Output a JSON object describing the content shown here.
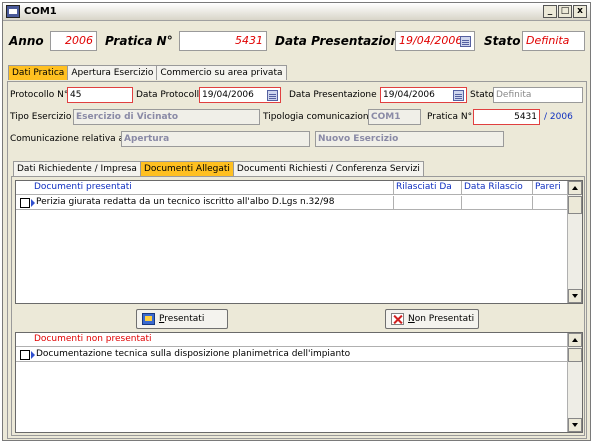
{
  "window": {
    "title": "COM1",
    "buttons": [
      "_",
      "□",
      "x"
    ]
  },
  "header": {
    "anno_label": "Anno",
    "anno_value": "2006",
    "pratica_label": "Pratica N°",
    "pratica_value": "5431",
    "data_label": "Data Presentazione",
    "data_value": "19/04/2006",
    "stato_label": "Stato",
    "stato_value": "Definita"
  },
  "main_tabs": [
    "Dati Pratica",
    "Apertura Esercizio",
    "Commercio su area privata"
  ],
  "form": {
    "protocollo_label": "Protocollo N°",
    "protocollo_value": "45",
    "data_protocollo_label": "Data Protocollo",
    "data_protocollo_value": "19/04/2006",
    "data_presentazione_label": "Data Presentazione",
    "data_presentazione_value": "19/04/2006",
    "stato_label": "Stato",
    "stato_value": "Definita",
    "tipo_esercizio_label": "Tipo Esercizio",
    "tipo_esercizio_value": "Esercizio di Vicinato",
    "tipologia_label": "Tipologia comunicazione",
    "tipologia_value": "COM1",
    "pratica_label": "Pratica N°",
    "pratica_value": "5431",
    "pratica_year": "/ 2006",
    "comunicazione_label": "Comunicazione relativa a",
    "comunicazione_value": "Apertura",
    "nuovo_esercizio_value": "Nuovo Esercizio"
  },
  "sub_tabs": [
    "Dati Richiedente / Impresa",
    "Documenti Allegati",
    "Documenti Richiesti / Conferenza Servizi"
  ],
  "presentati": {
    "columns": [
      "Documenti presentati",
      "Rilasciati Da",
      "Data Rilascio",
      "Pareri"
    ],
    "rows": [
      {
        "descrizione": "Perizia giurata redatta da un tecnico iscritto all'albo D.Lgs n.32/98",
        "rilasciati_da": "",
        "data_rilascio": "",
        "pareri": ""
      }
    ]
  },
  "buttons": {
    "presentati_first": "P",
    "presentati_rest": "resentati",
    "non_first": "N",
    "non_rest": "on Presentati"
  },
  "non_presentati": {
    "columns": [
      "Documenti non presentati"
    ],
    "rows": [
      {
        "descrizione": "Documentazione tecnica sulla disposizione planimetrica dell'impianto"
      }
    ]
  },
  "colors": {
    "accent_tab": "#ffc020",
    "required_text": "#e00000",
    "header_link": "#1030c0"
  },
  "icons": {
    "calendar": "calendar-icon",
    "presentati": "presentati-icon",
    "non_presentati": "non-presentati-icon"
  }
}
